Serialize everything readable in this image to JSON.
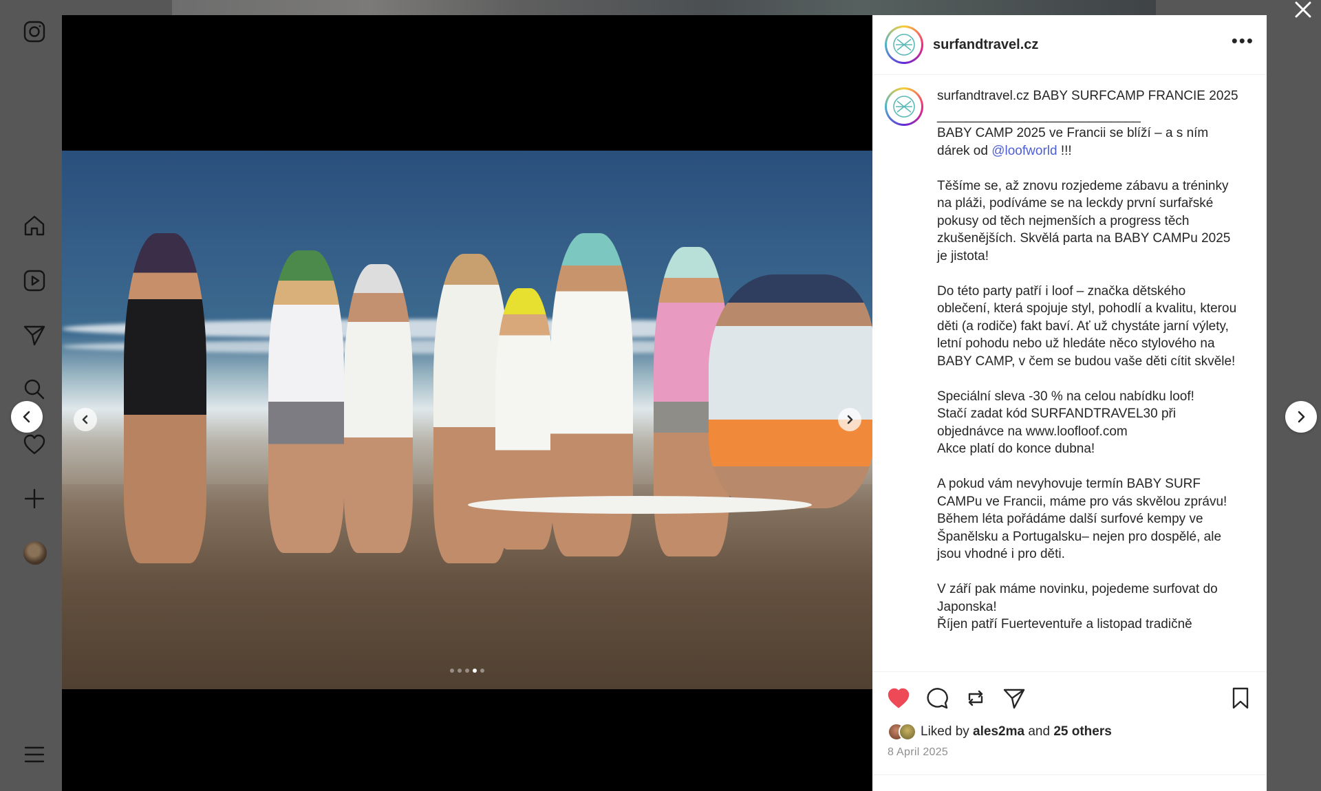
{
  "post": {
    "username": "surfandtravel.cz",
    "more_label": "•••",
    "caption": {
      "username": "surfandtravel.cz",
      "title": " BABY SURFCAMP FRANCIE 2025",
      "rule": "____________________________",
      "p1_a": "BABY CAMP 2025 ve Francii se blíží – a s ním dárek od ",
      "p1_mention": "@loofworld",
      "p1_b": " !!!",
      "p2": "Těšíme se, až znovu rozjedeme zábavu a tréninky na pláži, podíváme se na leckdy první surfařské pokusy od těch nejmenších a progress těch zkušenějších. Skvělá parta na BABY CAMPu 2025 je jistota!",
      "p3": "Do této party patří i loof – značka dětského oblečení, která spojuje styl, pohodlí a kvalitu, kterou děti (a rodiče) fakt baví. Ať už chystáte jarní výlety, letní pohodu nebo už hledáte něco stylového na BABY CAMP, v čem se budou vaše děti cítit skvěle!",
      "p4": "Speciální sleva -30 % na celou nabídku loof!\nStačí zadat kód SURFANDTRAVEL30 při objednávce na www.loofloof.com\nAkce platí do konce dubna!",
      "p5": "A pokud vám nevyhovuje termín BABY SURF CAMPu ve Francii, máme pro vás skvělou zprávu! Během léta pořádáme další surfové kempy ve Španělsku a Portugalsku– nejen pro dospělé, ale jsou vhodné i pro děti.",
      "p6": "V září pak máme novinku, pojedeme surfovat do Japonska!\nŘíjen patří Fuerteventuře a listopad tradičně"
    },
    "likes": {
      "prefix": "Liked by ",
      "user": "ales2ma",
      "middle": " and ",
      "others": "25 others"
    },
    "date": "8 April 2025",
    "liked": true,
    "colors": {
      "like": "#ed4956",
      "mention": "#4c5fd5"
    },
    "carousel": {
      "count": 5,
      "active_index": 3
    }
  },
  "icons": {
    "rail": [
      "instagram-icon",
      "home-icon",
      "reels-icon",
      "direct-icon",
      "search-icon",
      "notifications-icon",
      "create-icon",
      "profile-avatar",
      "menu-icon"
    ],
    "actions": [
      "heart-icon",
      "comment-icon",
      "repost-icon",
      "share-icon",
      "bookmark-icon"
    ]
  }
}
